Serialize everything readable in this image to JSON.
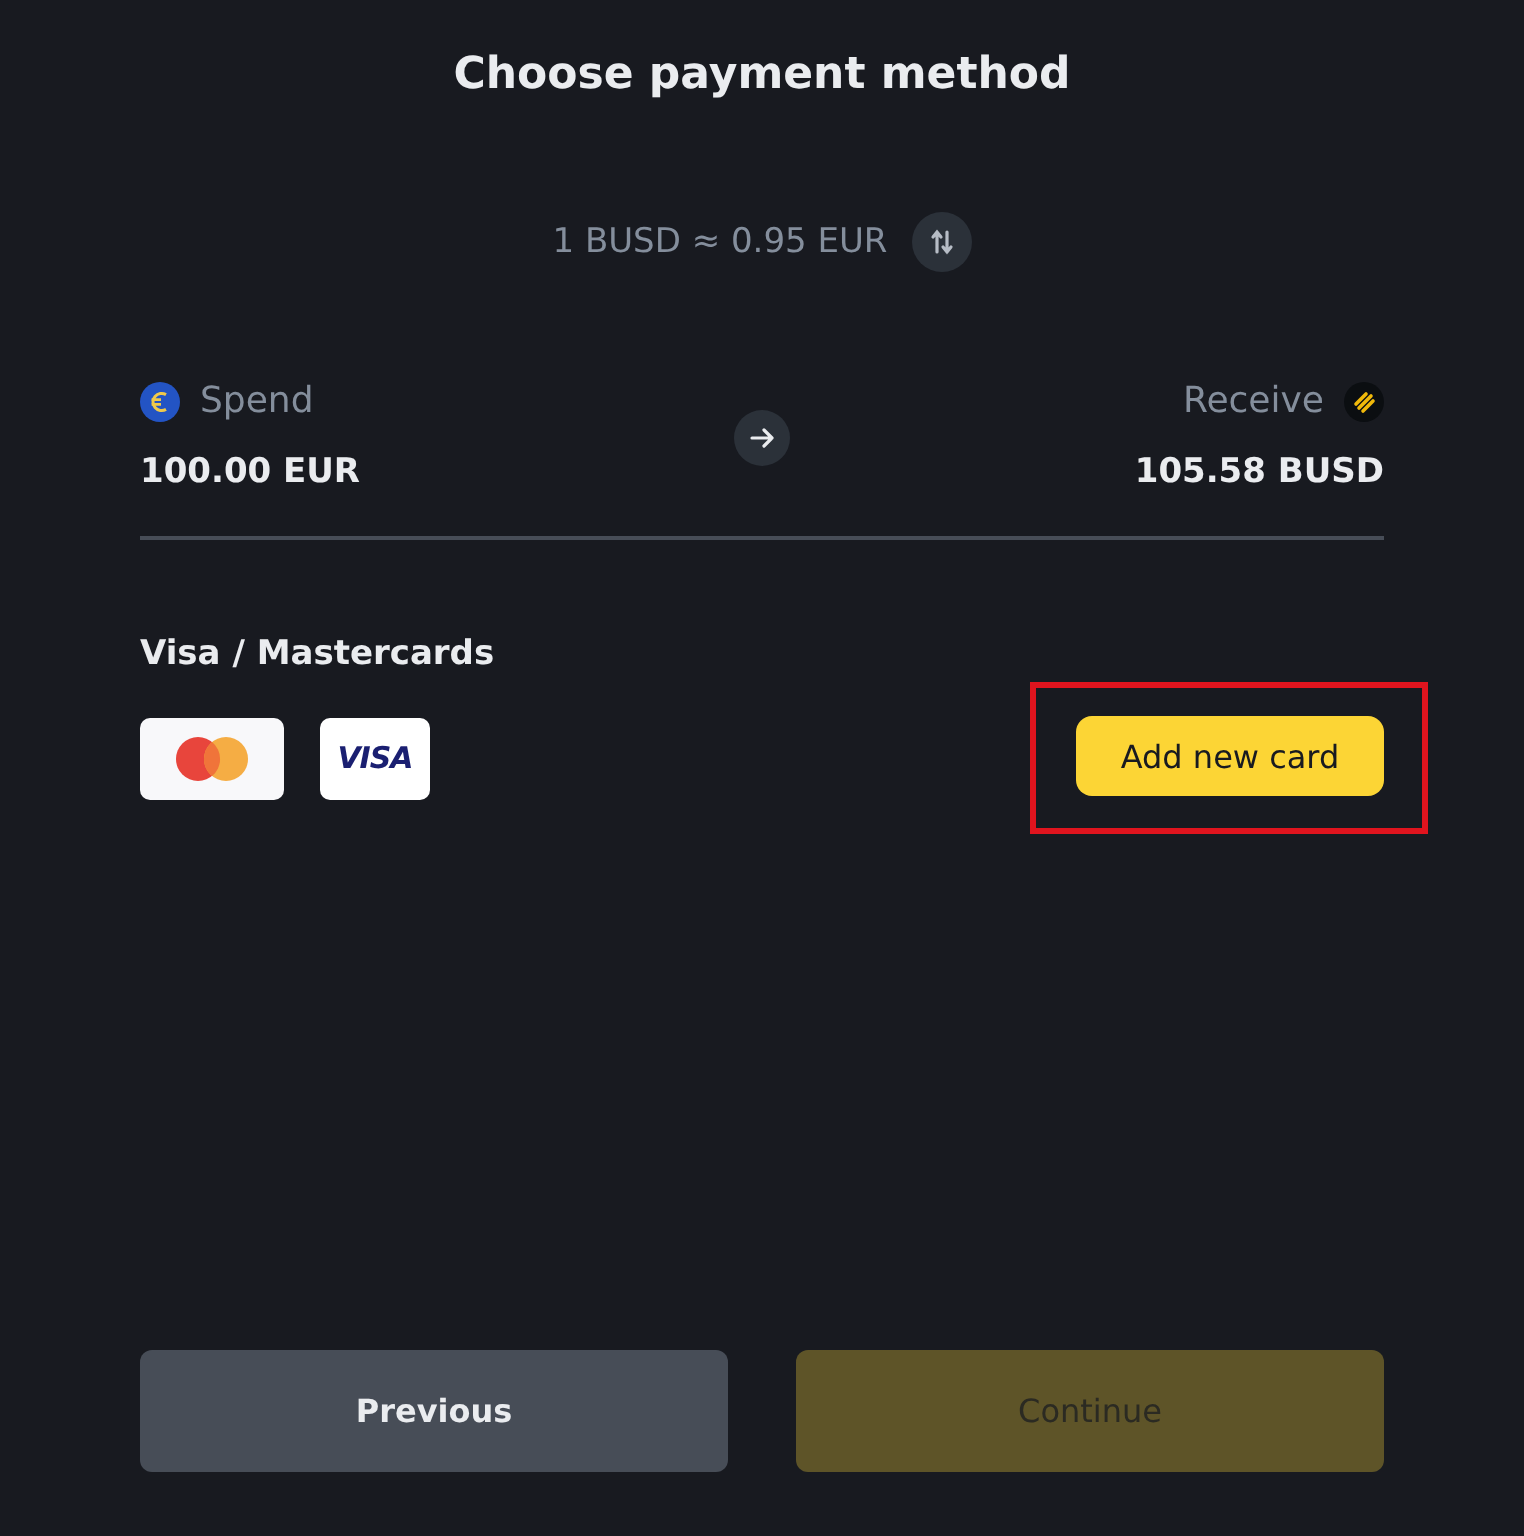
{
  "title": "Choose payment method",
  "rate": {
    "text": "1 BUSD ≈ 0.95 EUR"
  },
  "exchange": {
    "spend": {
      "label": "Spend",
      "amount": "100.00 EUR"
    },
    "receive": {
      "label": "Receive",
      "amount": "105.58 BUSD"
    }
  },
  "payment_section": {
    "heading": "Visa / Mastercards",
    "cards": [
      {
        "kind": "mastercard"
      },
      {
        "kind": "visa",
        "label": "VISA"
      }
    ],
    "add_card_button": {
      "label": "Add new card",
      "highlighted": true
    }
  },
  "footer_buttons": [
    {
      "label": "Previous",
      "kind": "secondary",
      "disabled": false
    },
    {
      "label": "Continue",
      "kind": "primary",
      "disabled": true
    }
  ]
}
